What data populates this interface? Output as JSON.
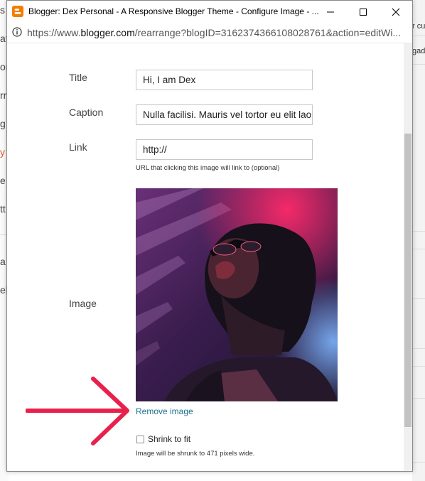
{
  "window": {
    "title": "Blogger: Dex Personal - A Responsive Blogger Theme - Configure Image - ...",
    "url_prefix": "https://www.",
    "url_domain": "blogger.com",
    "url_rest": "/rearrange?blogID=3162374366108028761&action=editWi..."
  },
  "background": {
    "left_fragments": [
      "s",
      "at",
      "or",
      "rr",
      "g",
      "y",
      "e",
      "tt",
      "a",
      "elj"
    ],
    "right_fragments": [
      "r cu",
      "gad"
    ]
  },
  "form": {
    "title_label": "Title",
    "title_value": "Hi, I am Dex",
    "caption_label": "Caption",
    "caption_value": "Nulla facilisi. Mauris vel tortor eu elit laoreet",
    "link_label": "Link",
    "link_value": "http://",
    "link_hint": "URL that clicking this image will link to (optional)",
    "image_label": "Image",
    "remove_image": "Remove image",
    "shrink_label": "Shrink to fit",
    "shrink_checked": false,
    "shrink_hint": "Image will be shrunk to 471 pixels wide."
  },
  "colors": {
    "blogger_orange": "#f57d00",
    "link_blue": "#1a6f8c",
    "arrow_red": "#e8204c",
    "accent_orange_text": "#e2572b"
  },
  "icons": {
    "favicon": "blogger-icon",
    "info": "info-icon",
    "minimize": "minimize-icon",
    "maximize": "maximize-icon",
    "close": "close-icon",
    "arrow": "arrow-right-icon"
  }
}
